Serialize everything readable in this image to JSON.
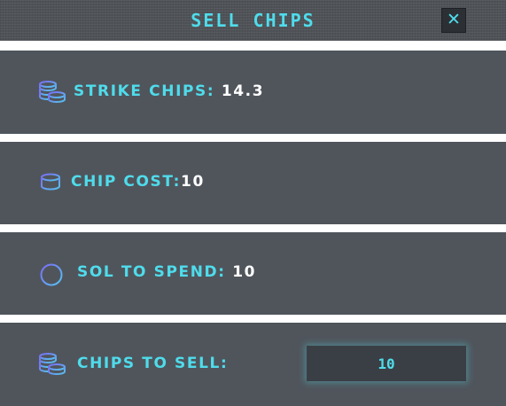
{
  "header": {
    "title": "SELL CHIPS",
    "close_symbol": "✕"
  },
  "rows": {
    "strike_chips": {
      "label": "STRIKE CHIPS:",
      "value": "14.3",
      "icon": "coin-stack-icon"
    },
    "chip_cost": {
      "label": "CHIP COST:",
      "value": "10",
      "icon": "single-chip-icon"
    },
    "sol_to_spend": {
      "label": "SOL TO SPEND:",
      "value": "10",
      "icon": "sol-token-icon"
    },
    "chips_to_sell": {
      "label": "CHIPS TO SELL:",
      "input_value": "10",
      "icon": "coin-stack-icon"
    }
  },
  "colors": {
    "accent": "#4fdceb",
    "panel": "#50555c",
    "header": "#4f5257",
    "value_text": "#ffffff",
    "input_bg": "#3a3f45",
    "icon_gradient": [
      "#7a6cf5",
      "#56c4f0"
    ]
  }
}
